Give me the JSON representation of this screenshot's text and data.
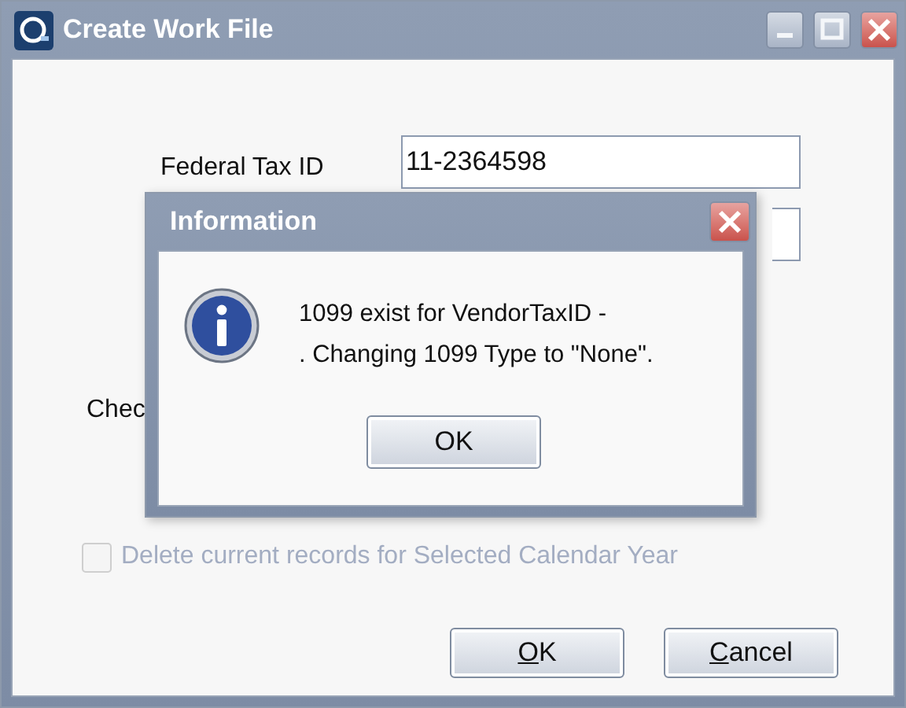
{
  "window": {
    "title": "Create Work File"
  },
  "fields": [
    {
      "label": "Federal Tax ID",
      "value": "11-2364598"
    }
  ],
  "covered_label": "Chec",
  "checkbox": {
    "label": "Delete current records for Selected Calendar Year",
    "checked": false,
    "disabled": true
  },
  "buttons": [
    {
      "label": "OK",
      "underline_first": true
    },
    {
      "label": "Cancel",
      "underline_first": true
    }
  ],
  "dialog": {
    "title": "Information",
    "message_lines": [
      "1099 exist for VendorTaxID -",
      ". Changing 1099 Type to \"None\"."
    ],
    "button": "OK"
  }
}
